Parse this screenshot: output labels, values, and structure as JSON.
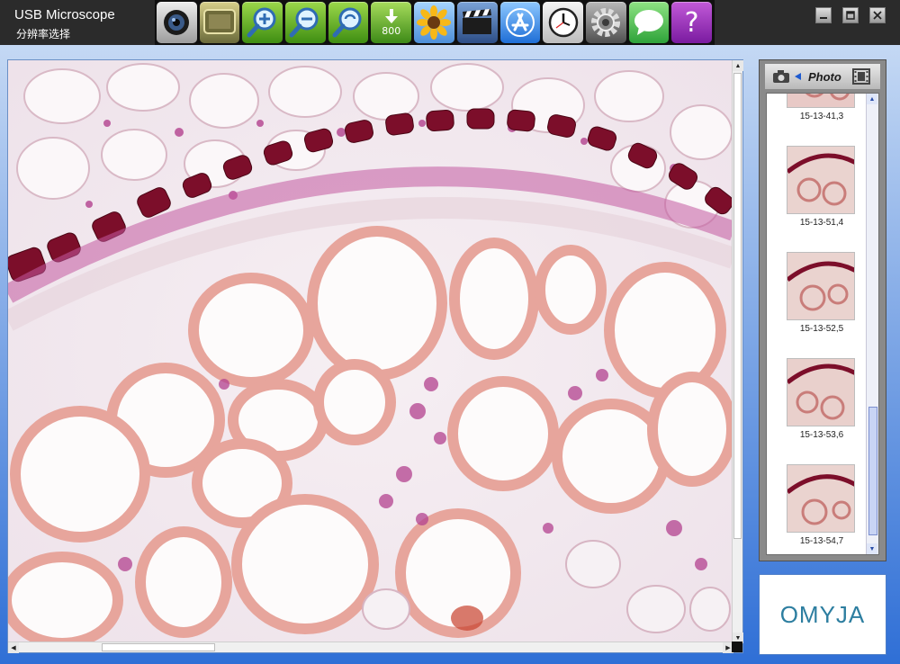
{
  "window": {
    "title": "USB Microscope",
    "subtitle": "分辨率选择"
  },
  "toolbar": {
    "buttons": [
      {
        "icon": "camera-icon"
      },
      {
        "icon": "display-icon"
      },
      {
        "icon": "zoom-in-icon"
      },
      {
        "icon": "zoom-out-icon"
      },
      {
        "icon": "zoom-fit-icon"
      },
      {
        "icon": "download-icon",
        "label": "800"
      },
      {
        "icon": "sunflower-icon"
      },
      {
        "icon": "video-icon"
      },
      {
        "icon": "app-store-icon"
      },
      {
        "icon": "clock-icon"
      },
      {
        "icon": "settings-gear-icon"
      },
      {
        "icon": "message-icon"
      },
      {
        "icon": "help-icon",
        "label": "?"
      }
    ]
  },
  "window_controls": [
    "minimize-icon",
    "restore-icon",
    "close-icon"
  ],
  "photo_panel": {
    "header_label": "Photo",
    "thumbnails": [
      {
        "label": "15-13-41,3"
      },
      {
        "label": "15-13-51,4"
      },
      {
        "label": "15-13-52,5"
      },
      {
        "label": "15-13-53,6"
      },
      {
        "label": "15-13-54,7"
      }
    ]
  },
  "brand": {
    "logo_text": "OMYJA"
  },
  "colors": {
    "toolbar_bg": "#101010",
    "background_top": "#cfe0f6",
    "background_bottom": "#2f6fd6",
    "stain_pink": "#e7a59c",
    "stain_magenta": "#b3428f",
    "stain_dark": "#7c0e2a",
    "logo": "#2d7ea0"
  }
}
